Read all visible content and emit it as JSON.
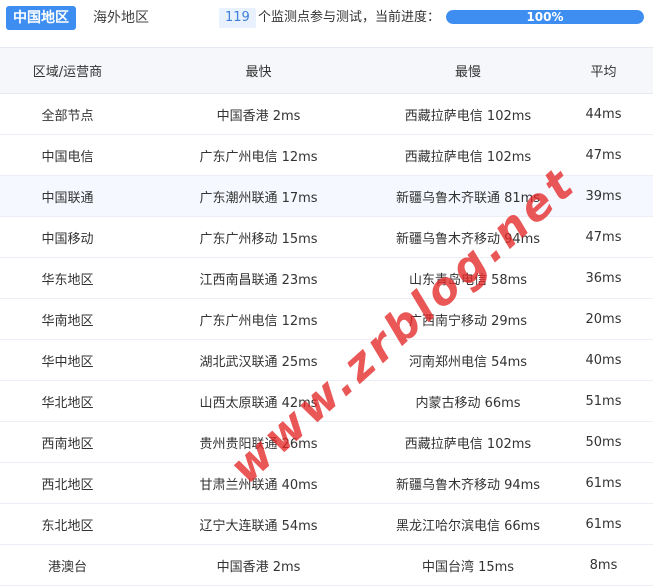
{
  "tabs": {
    "china": "中国地区",
    "overseas": "海外地区"
  },
  "monitor": {
    "count": "119",
    "status_text": "个监测点参与测试，当前进度：",
    "progress_label": "100%",
    "progress_fraction": 1.0
  },
  "colors": {
    "accent": "#3d8ef0",
    "watermark": "#e42828"
  },
  "table": {
    "headers": [
      "区域/运营商",
      "最快",
      "最慢",
      "平均"
    ],
    "rows": [
      [
        "全部节点",
        "中国香港 2ms",
        "西藏拉萨电信 102ms",
        "44ms"
      ],
      [
        "中国电信",
        "广东广州电信 12ms",
        "西藏拉萨电信 102ms",
        "47ms"
      ],
      [
        "中国联通",
        "广东潮州联通 17ms",
        "新疆乌鲁木齐联通 81ms",
        "39ms"
      ],
      [
        "中国移动",
        "广东广州移动 15ms",
        "新疆乌鲁木齐移动 94ms",
        "47ms"
      ],
      [
        "华东地区",
        "江西南昌联通 23ms",
        "山东青岛电信 58ms",
        "36ms"
      ],
      [
        "华南地区",
        "广东广州电信 12ms",
        "广西南宁移动 29ms",
        "20ms"
      ],
      [
        "华中地区",
        "湖北武汉联通 25ms",
        "河南郑州电信 54ms",
        "40ms"
      ],
      [
        "华北地区",
        "山西太原联通 42ms",
        "内蒙古移动 66ms",
        "51ms"
      ],
      [
        "西南地区",
        "贵州贵阳联通 26ms",
        "西藏拉萨电信 102ms",
        "50ms"
      ],
      [
        "西北地区",
        "甘肃兰州联通 40ms",
        "新疆乌鲁木齐移动 94ms",
        "61ms"
      ],
      [
        "东北地区",
        "辽宁大连联通 54ms",
        "黑龙江哈尔滨电信 66ms",
        "61ms"
      ],
      [
        "港澳台",
        "中国香港 2ms",
        "中国台湾 15ms",
        "8ms"
      ]
    ]
  },
  "watermark": "www.zrblog.net"
}
